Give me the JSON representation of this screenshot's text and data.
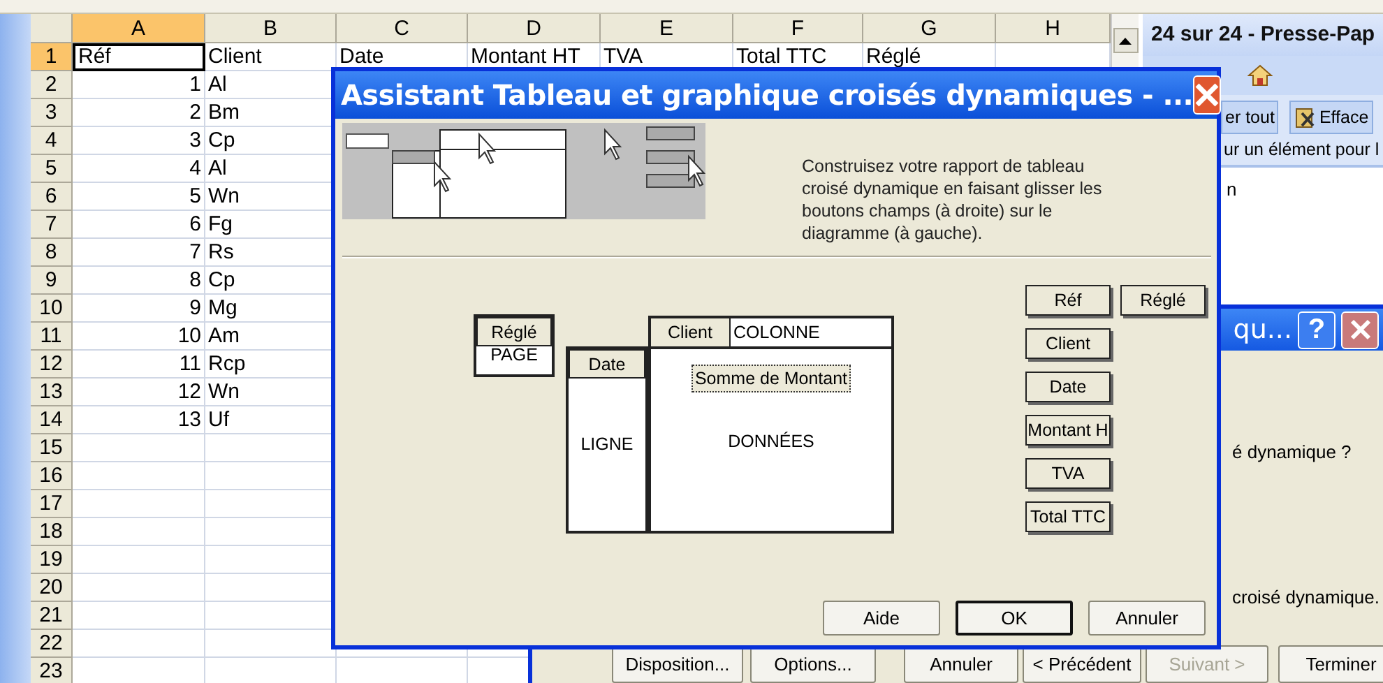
{
  "spreadsheet": {
    "columns": [
      {
        "label": "A",
        "selected": true
      },
      {
        "label": "B",
        "selected": false
      },
      {
        "label": "C",
        "selected": false
      },
      {
        "label": "D",
        "selected": false
      },
      {
        "label": "E",
        "selected": false
      },
      {
        "label": "F",
        "selected": false
      },
      {
        "label": "G",
        "selected": false
      },
      {
        "label": "H",
        "selected": false
      }
    ],
    "rows": [
      {
        "label": "1",
        "selected": true,
        "cells": [
          "Réf",
          "Client",
          "Date",
          "Montant HT",
          "TVA",
          "Total TTC",
          "Réglé"
        ]
      },
      {
        "label": "2",
        "selected": false,
        "cells": [
          "1",
          "Al"
        ]
      },
      {
        "label": "3",
        "selected": false,
        "cells": [
          "2",
          "Bm"
        ]
      },
      {
        "label": "4",
        "selected": false,
        "cells": [
          "3",
          "Cp"
        ]
      },
      {
        "label": "5",
        "selected": false,
        "cells": [
          "4",
          "Al"
        ]
      },
      {
        "label": "6",
        "selected": false,
        "cells": [
          "5",
          "Wn"
        ]
      },
      {
        "label": "7",
        "selected": false,
        "cells": [
          "6",
          "Fg"
        ]
      },
      {
        "label": "8",
        "selected": false,
        "cells": [
          "7",
          "Rs"
        ]
      },
      {
        "label": "9",
        "selected": false,
        "cells": [
          "8",
          "Cp"
        ]
      },
      {
        "label": "10",
        "selected": false,
        "cells": [
          "9",
          "Mg"
        ]
      },
      {
        "label": "11",
        "selected": false,
        "cells": [
          "10",
          "Am"
        ]
      },
      {
        "label": "12",
        "selected": false,
        "cells": [
          "11",
          "Rcp"
        ]
      },
      {
        "label": "13",
        "selected": false,
        "cells": [
          "12",
          "Wn"
        ]
      },
      {
        "label": "14",
        "selected": false,
        "cells": [
          "13",
          "Uf"
        ]
      },
      {
        "label": "15",
        "selected": false
      },
      {
        "label": "16",
        "selected": false
      },
      {
        "label": "17",
        "selected": false
      },
      {
        "label": "18",
        "selected": false
      },
      {
        "label": "19",
        "selected": false
      },
      {
        "label": "20",
        "selected": false
      },
      {
        "label": "21",
        "selected": false
      },
      {
        "label": "22",
        "selected": false
      },
      {
        "label": "23",
        "selected": false
      }
    ]
  },
  "task_pane": {
    "title": "24 sur 24 - Presse-Pap",
    "buttons": [
      "er tout",
      "Efface"
    ],
    "hint": "ur un élément pour l",
    "text": "n"
  },
  "back_dialog": {
    "title": "qu...",
    "help": "?",
    "lines": [
      "é dynamique ?",
      "croisé dynamique."
    ],
    "buttons": [
      {
        "label": "Disposition...",
        "disabled": false
      },
      {
        "label": "Options...",
        "disabled": false
      },
      {
        "label": "Annuler",
        "disabled": false
      },
      {
        "label": "< Précédent",
        "disabled": false
      },
      {
        "label": "Suivant >",
        "disabled": true
      },
      {
        "label": "Terminer",
        "disabled": false
      }
    ]
  },
  "dialog": {
    "title": "Assistant Tableau et graphique croisés dynamiques - ...",
    "description": "Construisez votre rapport de tableau croisé dynamique en faisant glisser les boutons champs (à droite) sur le diagramme (à gauche).",
    "page_area": {
      "label": "PAGE",
      "field": "Réglé"
    },
    "row_area": {
      "label": "LIGNE",
      "field": "Date"
    },
    "column_area": {
      "label": "COLONNE",
      "field": "Client"
    },
    "data_area": {
      "label": "DONNÉES",
      "field": "Somme de Montant"
    },
    "fields": [
      "Réf",
      "Réglé",
      "Client",
      "Date",
      "Montant H",
      "TVA",
      "Total TTC"
    ],
    "buttons": [
      {
        "label": "Aide",
        "default": false
      },
      {
        "label": "OK",
        "default": true
      },
      {
        "label": "Annuler",
        "default": false
      }
    ]
  }
}
